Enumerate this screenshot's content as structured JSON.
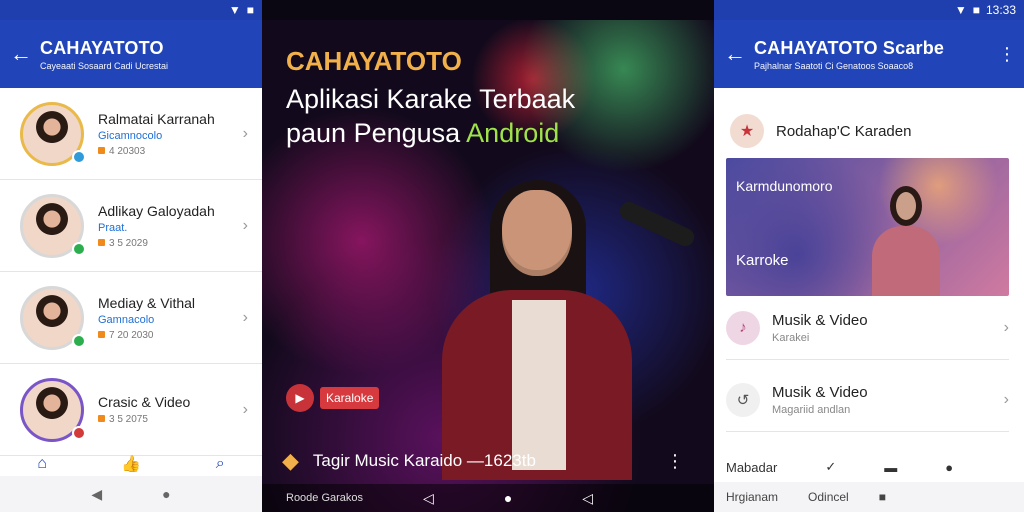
{
  "left": {
    "status": {
      "icons": [
        "▼",
        "■"
      ]
    },
    "header": {
      "back": "←",
      "title": "CAHAYATOTO",
      "subtitle": "Cayeaati Sosaard Cadi Ucrestai"
    },
    "contacts": [
      {
        "name": "Ralmatai Karranah",
        "status": "Gicamnocolo",
        "meta": "4 20303",
        "badge_color": "#2f9bd8"
      },
      {
        "name": "Adlikay Galoyadah",
        "status": "Praat.",
        "meta": "3 5 2029",
        "badge_color": "#2cae4f"
      },
      {
        "name": "Mediay & Vithal",
        "status": "Gamnacolo",
        "meta": "7 20 2030",
        "badge_color": "#2cae4f"
      },
      {
        "name": "Crasic & Video",
        "status": "",
        "meta": "3 5 2075",
        "badge_color": "#d33a3a"
      }
    ],
    "nav": [
      "⌂",
      "👍",
      "⌕"
    ],
    "sys": [
      "◀",
      "●"
    ]
  },
  "middle": {
    "brand": "CAHAYATOTO",
    "headline_line1": "Aplikasi Karake Terbaak",
    "headline_line2_prefix": "paun Pengusa ",
    "headline_line2_highlight": "Android",
    "chip_label": "Karaloke",
    "nowplaying": "Tagir Music  Karaido  —1623tb",
    "bottom_label": "Roode Garakos",
    "navs": [
      "◁",
      "●",
      "◁"
    ]
  },
  "right": {
    "status": {
      "time": "13:33"
    },
    "header": {
      "back": "←",
      "title": "CAHAYATOTO Scarbe",
      "subtitle": "Pajhalnar Saatoti Ci Genatoos Soaaco8"
    },
    "featured": "Rodahap'C Karaden",
    "banner": {
      "title": "Karmdunomoro",
      "caption": "Karroke"
    },
    "items": [
      {
        "title": "Musik & Video",
        "subtitle": "Karakei",
        "icon_color": "#b04a7a"
      },
      {
        "title": "Musik & Video",
        "subtitle": "Magariid andlan",
        "icon_color": "#555555"
      }
    ],
    "bottom_label": "Mabadar",
    "footer": [
      "Hrgianam",
      "Odincel",
      "■"
    ]
  }
}
